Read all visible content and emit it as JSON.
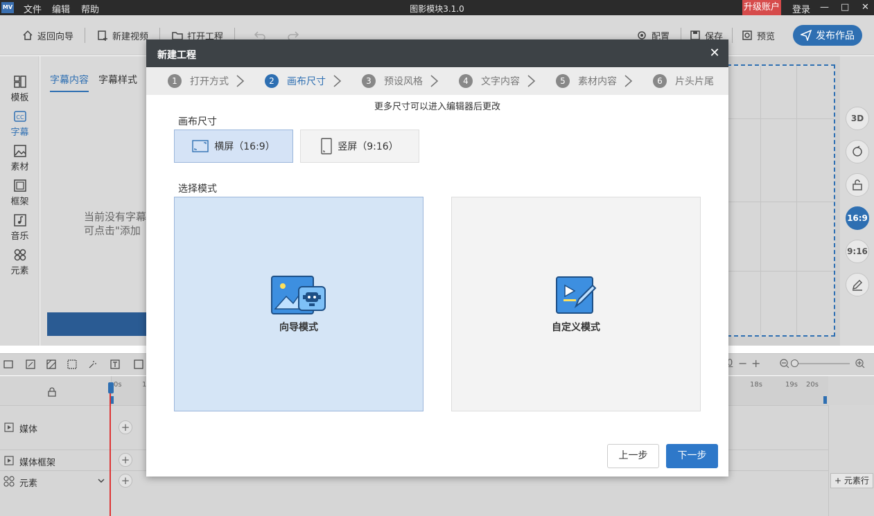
{
  "titlebar": {
    "logo": "MV",
    "menus": [
      "文件",
      "编辑",
      "帮助"
    ],
    "title": "图影模块3.1.0",
    "upgrade": "升级账户",
    "login": "登录",
    "minimize": "—",
    "maximize": "□",
    "close": "✕"
  },
  "toolbar": {
    "back_guide": "返回向导",
    "new_video": "新建视频",
    "open_project": "打开工程",
    "config": "配置",
    "save": "保存",
    "preview": "预览",
    "publish": "发布作品"
  },
  "leftnav": [
    "模板",
    "字幕",
    "素材",
    "框架",
    "音乐",
    "元素"
  ],
  "panel": {
    "tabs": [
      "字幕内容",
      "字幕样式"
    ],
    "empty_line1": "当前没有字幕",
    "empty_line2": "可点击\"添加"
  },
  "rightbar": {
    "ratio_169": "16:9",
    "ratio_916": "9:16",
    "threed": "3D"
  },
  "timeline": {
    "tracks": [
      "媒体",
      "媒体框架",
      "元素"
    ],
    "ruler_labels": [
      "0s",
      "1",
      "18s",
      "19s",
      "20s"
    ],
    "zoom_value": "0",
    "add_row": "元素行"
  },
  "modal": {
    "title": "新建工程",
    "close": "✕",
    "steps": [
      {
        "num": "1",
        "label": "打开方式"
      },
      {
        "num": "2",
        "label": "画布尺寸"
      },
      {
        "num": "3",
        "label": "预设风格"
      },
      {
        "num": "4",
        "label": "文字内容"
      },
      {
        "num": "5",
        "label": "素材内容"
      },
      {
        "num": "6",
        "label": "片头片尾"
      }
    ],
    "active_step": 2,
    "hint": "更多尺寸可以进入编辑器后更改",
    "size_label": "画布尺寸",
    "size_options": [
      "横屏（16:9）",
      "竖屏（9:16）"
    ],
    "selected_size": "横屏（16:9）",
    "mode_label": "选择模式",
    "modes": [
      "向导模式",
      "自定义模式"
    ],
    "selected_mode": "向导模式",
    "prev": "上一步",
    "next": "下一步"
  },
  "colors": {
    "accent": "#2e6fb2",
    "titlebar": "#2b2b2b",
    "upgrade": "#d64b4b",
    "selected_bg": "#d5e3f6"
  }
}
